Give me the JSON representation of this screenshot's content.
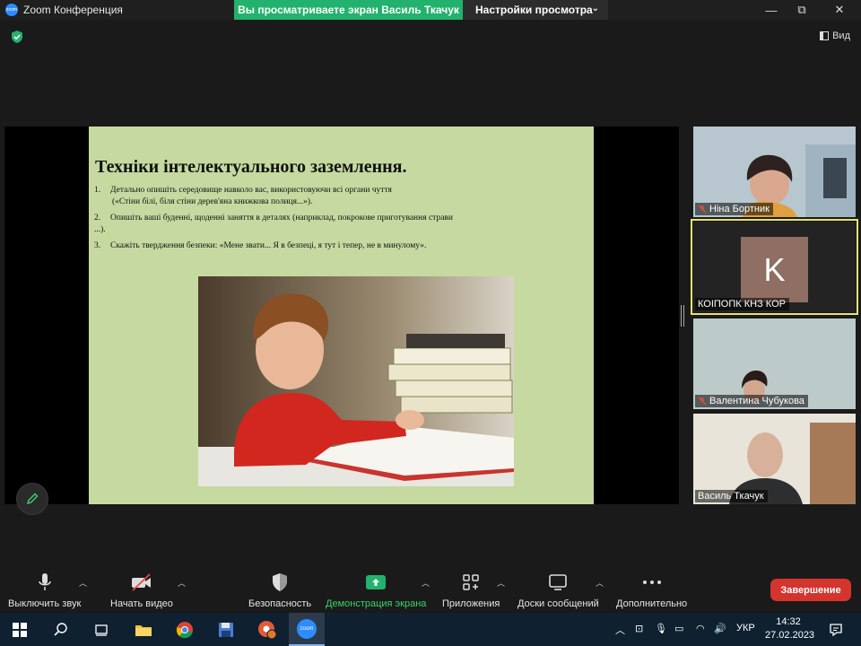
{
  "window": {
    "app_title": "Zoom Конференция",
    "app_logo_text": "zoom",
    "share_banner": "Вы просматриваете экран Василь Ткачук",
    "view_settings": "Настройки просмотра",
    "minimize": "—",
    "maximize": "⧉",
    "close": "✕"
  },
  "meeting_top": {
    "view_label": "Вид"
  },
  "slide": {
    "title": "Техніки інтелектуального заземлення.",
    "items": [
      {
        "num": "1.",
        "text": "Детально опишіть середовище навколо вас, використовуючи всі органи чуття",
        "continuation": "(«Стіни білі, біля стіни дерев'яна книжкова полиця...»)."
      },
      {
        "num": "2.",
        "text": "Опишіть ваші буденні, щоденні заняття в деталях (наприклад, покрокове приготування страви ...)."
      },
      {
        "num": "3.",
        "text": "Скажіть твердження безпеки: «Мене звати... Я в безпеці, я тут і тепер, не в минулому»."
      }
    ]
  },
  "participants": [
    {
      "name": "Ніна Бортник",
      "muted": true
    },
    {
      "name": "КОІПОПК КНЗ КОР",
      "muted": false,
      "avatar_letter": "K",
      "active_speaker": true
    },
    {
      "name": "Валентина Чубукова",
      "muted": true
    },
    {
      "name": "Василь Ткачук",
      "muted": false
    }
  ],
  "toolbar": {
    "mute": "Выключить звук",
    "video": "Начать видео",
    "security": "Безопасность",
    "share": "Демонстрация экрана",
    "apps": "Приложения",
    "whiteboards": "Доски сообщений",
    "more": "Дополнительно",
    "end": "Завершение"
  },
  "taskbar": {
    "language": "УКР",
    "time": "14:32",
    "date": "27.02.2023",
    "zoom_label": "zoom"
  },
  "colors": {
    "share_green": "#23b26d",
    "end_red": "#d3352e",
    "active_outline": "#e6e26e",
    "slide_bg": "#c6d9a0"
  }
}
